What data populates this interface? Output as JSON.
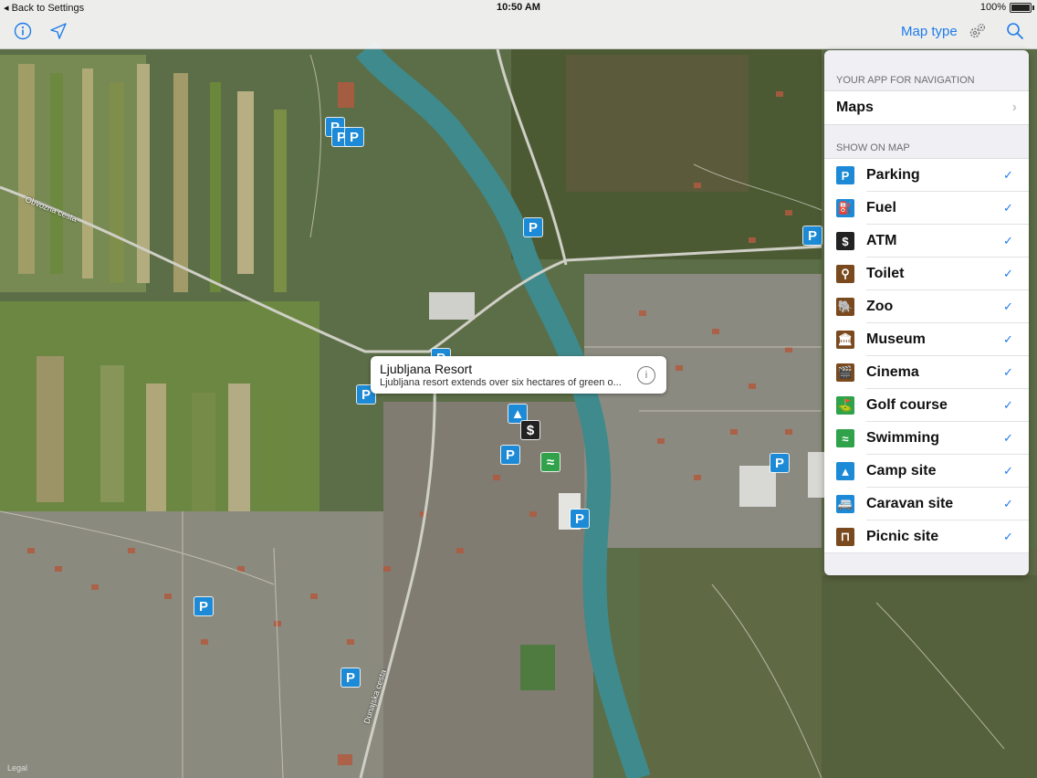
{
  "status_bar": {
    "back_label": "Back to Settings",
    "time": "10:50 AM",
    "battery": "100%"
  },
  "toolbar": {
    "info_icon": "info-icon",
    "location_icon": "location-arrow-icon",
    "map_type_label": "Map type",
    "settings_icon": "gears-icon",
    "search_icon": "search-icon"
  },
  "panel": {
    "nav_section_header": "YOUR APP FOR NAVIGATION",
    "nav_app": "Maps",
    "show_section_header": "SHOW ON MAP",
    "items": [
      {
        "label": "Parking",
        "icon": "parking-icon",
        "color": "#1c8ad6",
        "glyph": "P",
        "checked": true
      },
      {
        "label": "Fuel",
        "icon": "fuel-icon",
        "color": "#1c8ad6",
        "glyph": "⛽",
        "checked": true
      },
      {
        "label": "ATM",
        "icon": "atm-icon",
        "color": "#222222",
        "glyph": "$",
        "checked": true
      },
      {
        "label": "Toilet",
        "icon": "toilet-icon",
        "color": "#7a4a1e",
        "glyph": "⚲",
        "checked": true
      },
      {
        "label": "Zoo",
        "icon": "zoo-icon",
        "color": "#7a4a1e",
        "glyph": "🐘",
        "checked": true
      },
      {
        "label": "Museum",
        "icon": "museum-icon",
        "color": "#7a4a1e",
        "glyph": "🏛",
        "checked": true
      },
      {
        "label": "Cinema",
        "icon": "cinema-icon",
        "color": "#7a4a1e",
        "glyph": "🎬",
        "checked": true
      },
      {
        "label": "Golf course",
        "icon": "golf-icon",
        "color": "#2fa24a",
        "glyph": "⛳",
        "checked": true
      },
      {
        "label": "Swimming",
        "icon": "swimming-icon",
        "color": "#2fa24a",
        "glyph": "≈",
        "checked": true
      },
      {
        "label": "Camp site",
        "icon": "camp-site-icon",
        "color": "#1c8ad6",
        "glyph": "▲",
        "checked": true
      },
      {
        "label": "Caravan site",
        "icon": "caravan-icon",
        "color": "#1c8ad6",
        "glyph": "🚐",
        "checked": true
      },
      {
        "label": "Picnic site",
        "icon": "picnic-icon",
        "color": "#7a4a1e",
        "glyph": "⊓",
        "checked": true
      }
    ]
  },
  "callout": {
    "title": "Ljubljana Resort",
    "description": "Ljubljana resort extends over six hectares of green o..."
  },
  "map": {
    "road_labels": [
      "Obvozna cesta",
      "Dunajska cesta"
    ],
    "legal_label": "Legal"
  }
}
